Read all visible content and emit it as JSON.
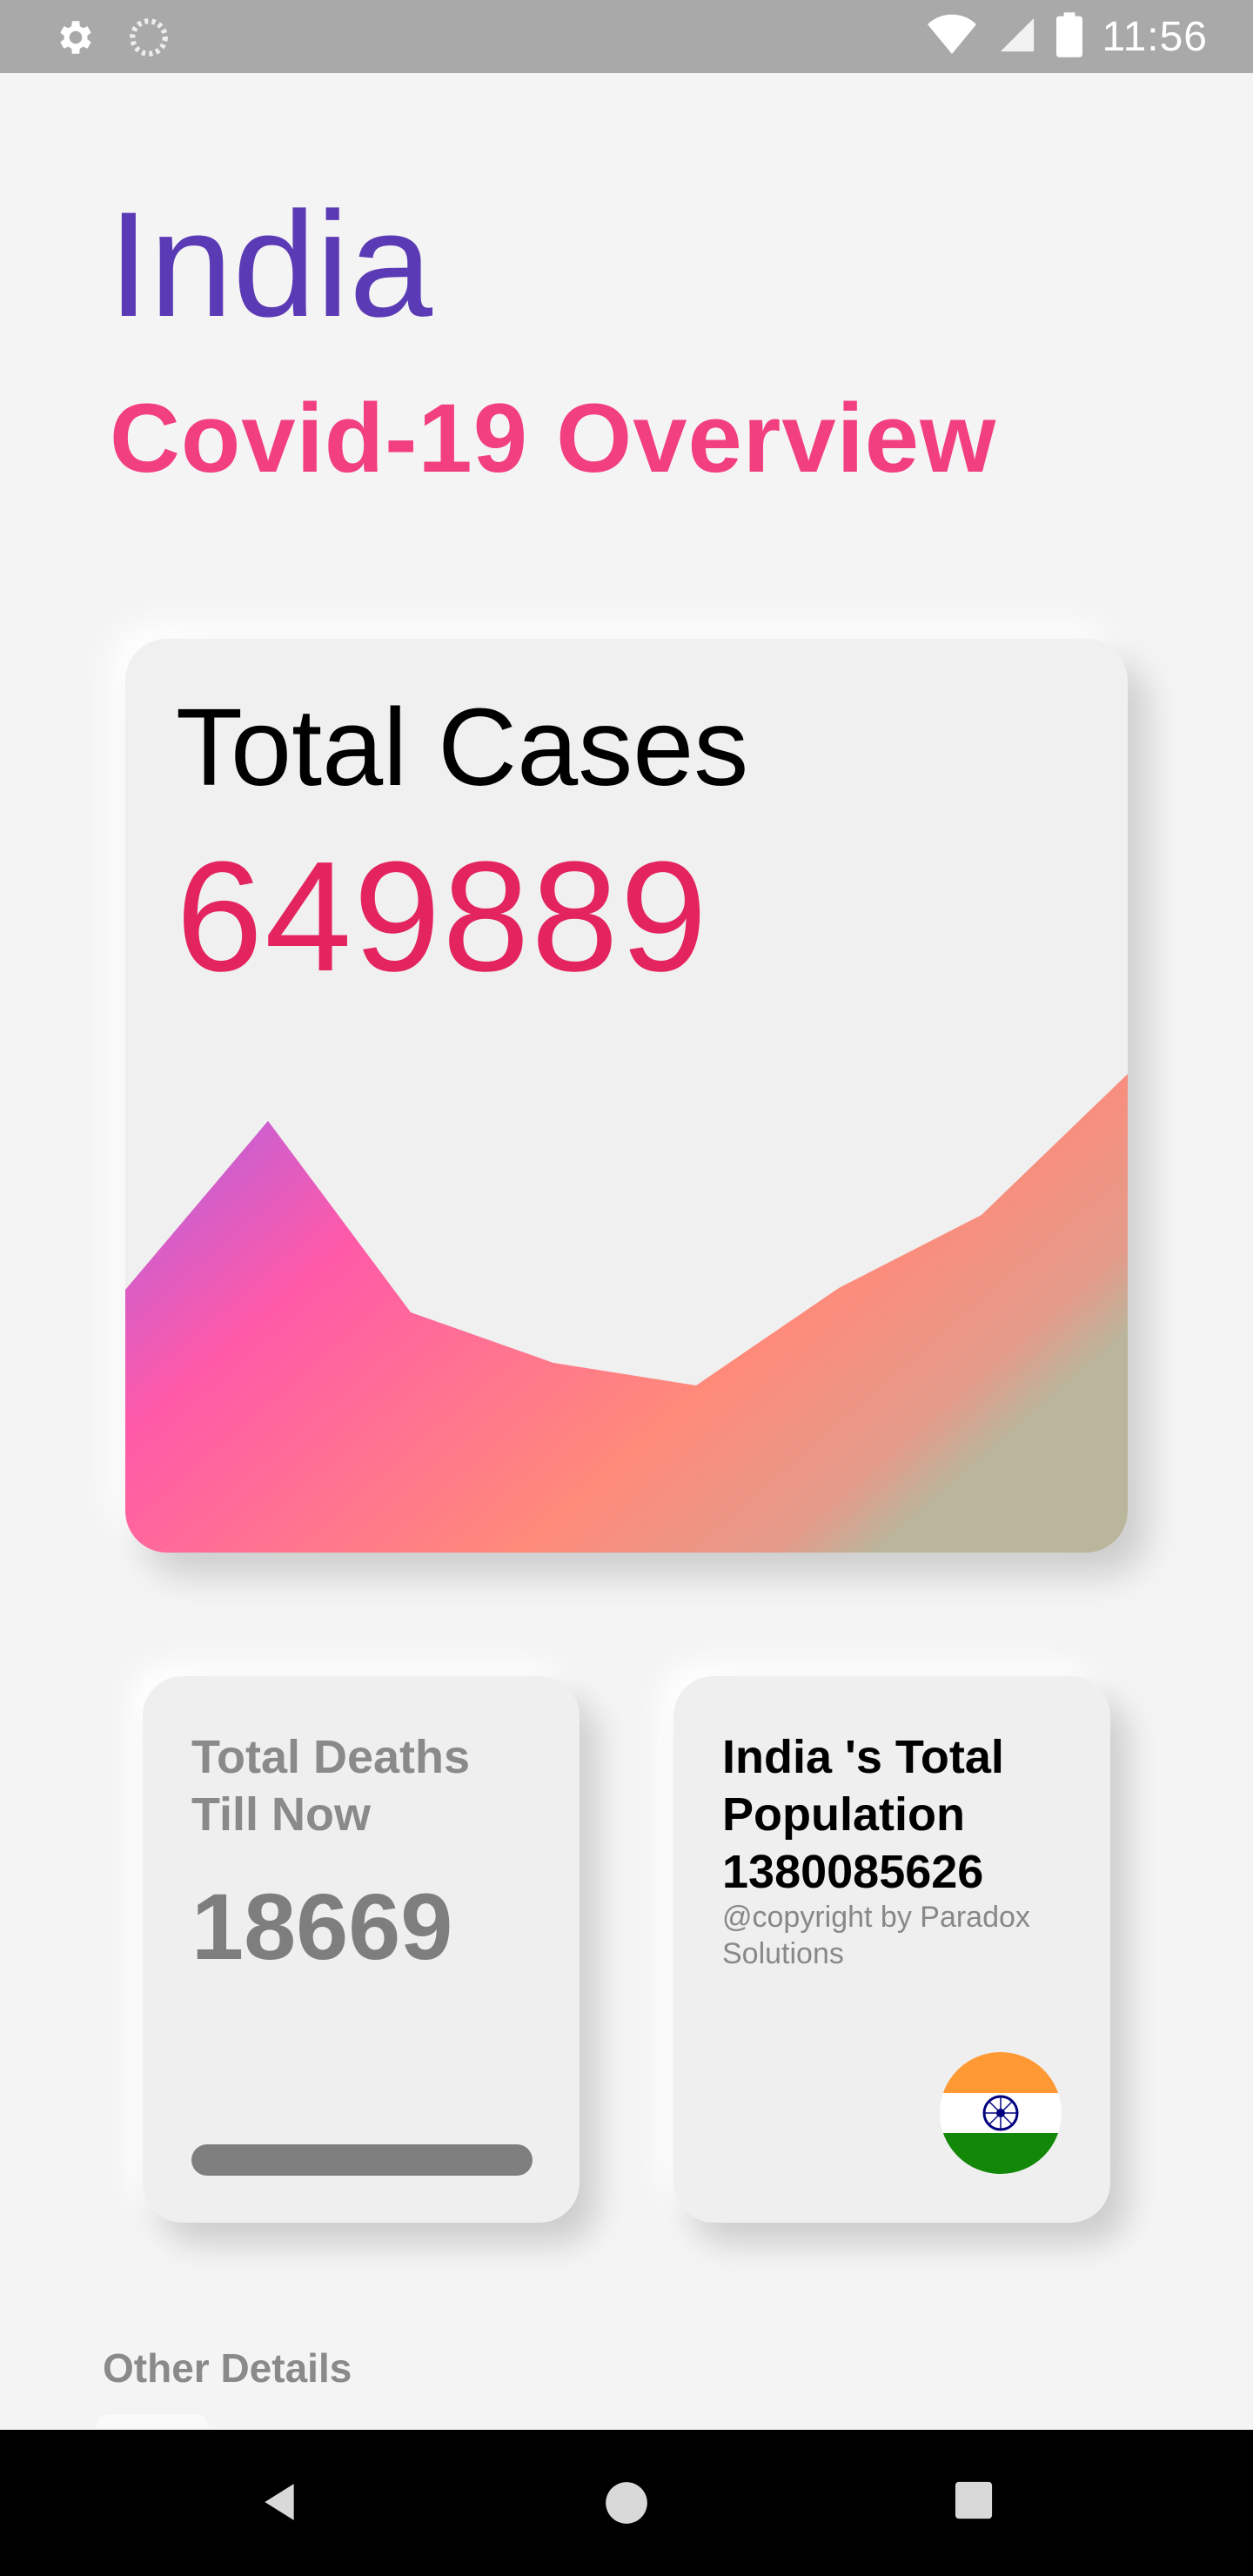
{
  "status_bar": {
    "time": "11:56",
    "left_icons": [
      "settings-icon",
      "sync-icon"
    ],
    "right_icons": [
      "wifi-icon",
      "signal-icon",
      "battery-icon"
    ]
  },
  "header": {
    "country": "India",
    "subtitle": "Covid-19 Overview"
  },
  "total_cases": {
    "label": "Total Cases",
    "value": "649889"
  },
  "deaths": {
    "label": "Total Deaths Till Now",
    "value": "18669"
  },
  "population": {
    "label": "India 's Total Population 1380085626",
    "copyright": "@copyright by Paradox Solutions",
    "flag_icon": "india-flag-icon"
  },
  "other_details": {
    "label": "Other Details"
  },
  "nav_bar": {
    "icons": [
      "back-icon",
      "home-icon",
      "recents-icon"
    ]
  },
  "colors": {
    "country": "#5b3bb5",
    "subtitle": "#f23f7f",
    "cases_value": "#e3245f",
    "chart_gradient": [
      "#c95ad6",
      "#ff5aa8",
      "#ff8a7a",
      "#b8b8a0"
    ]
  }
}
